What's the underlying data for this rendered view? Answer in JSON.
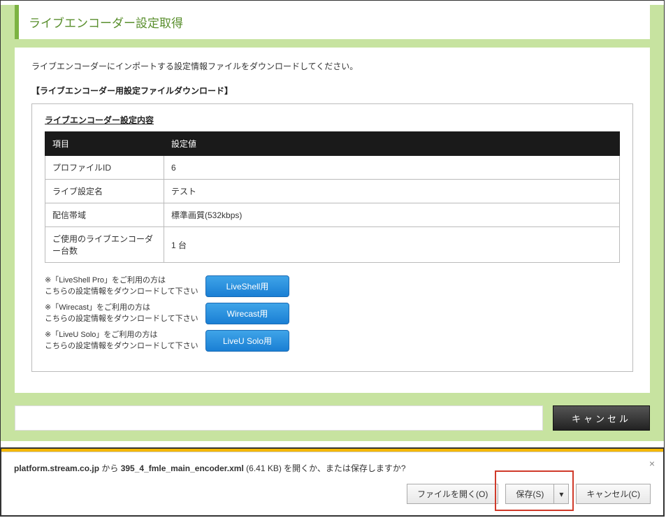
{
  "header": {
    "title": "ライブエンコーダー設定取得"
  },
  "intro": "ライブエンコーダーにインポートする設定情報ファイルをダウンロードしてください。",
  "sectionHeading": "【ライブエンコーダー用設定ファイルダウンロード】",
  "subHeading": "ライブエンコーダー設定内容",
  "table": {
    "headers": {
      "col1": "項目",
      "col2": "設定値"
    },
    "rows": [
      {
        "label": "プロファイルID",
        "value": "6"
      },
      {
        "label": "ライブ設定名",
        "value": "テスト"
      },
      {
        "label": "配信帯域",
        "value": "標準画質(532kbps)"
      },
      {
        "label": "ご使用のライブエンコーダー台数",
        "value": "1 台"
      }
    ]
  },
  "downloads": [
    {
      "note": "※「LiveShell Pro」をご利用の方は\nこちらの設定情報をダウンロードして下さい",
      "button": "LiveShell用"
    },
    {
      "note": "※「Wirecast」をご利用の方は\nこちらの設定情報をダウンロードして下さい",
      "button": "Wirecast用"
    },
    {
      "note": "※「LiveU Solo」をご利用の方は\nこちらの設定情報をダウンロードして下さい",
      "button": "LiveU Solo用"
    }
  ],
  "cancelLabel": "キャンセル",
  "downloadBar": {
    "domain": "platform.stream.co.jp",
    "from": " から ",
    "filename": "395_4_fmle_main_encoder.xml",
    "size": " (6.41 KB) ",
    "tail": "を開くか、または保存しますか?",
    "openLabel": "ファイルを開く(O)",
    "saveLabel": "保存(S)",
    "dropdownGlyph": "▾",
    "cancelLabel": "キャンセル(C)",
    "closeGlyph": "×"
  }
}
